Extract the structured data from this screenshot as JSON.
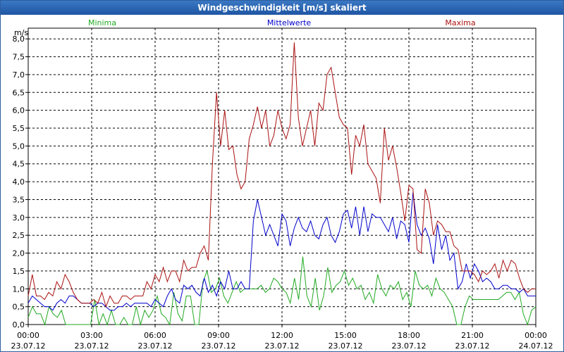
{
  "window": {
    "title": "Windgeschwindigkeit [m/s] skaliert"
  },
  "chart_data": {
    "type": "line",
    "title": "Windgeschwindigkeit [m/s] skaliert",
    "ylabel": "m/s",
    "ylim": [
      0,
      8
    ],
    "xlim": [
      0,
      96
    ],
    "grid": true,
    "legend": "top",
    "yticks": [
      "0,0",
      "0,5",
      "1,0",
      "1,5",
      "2,0",
      "2,5",
      "3,0",
      "3,5",
      "4,0",
      "4,5",
      "5,0",
      "5,5",
      "6,0",
      "6,5",
      "7,0",
      "7,5",
      "8,0"
    ],
    "xticks": [
      {
        "time": "00:00",
        "date": "23.07.12"
      },
      {
        "time": "03:00",
        "date": "23.07.12"
      },
      {
        "time": "06:00",
        "date": "23.07.12"
      },
      {
        "time": "09:00",
        "date": "23.07.12"
      },
      {
        "time": "12:00",
        "date": "23.07.12"
      },
      {
        "time": "15:00",
        "date": "23.07.12"
      },
      {
        "time": "18:00",
        "date": "23.07.12"
      },
      {
        "time": "21:00",
        "date": "23.07.12"
      },
      {
        "time": "00:00",
        "date": "24.07.12"
      }
    ],
    "series": [
      {
        "name": "Minima",
        "color": "#22aa22",
        "values": [
          0.2,
          0.5,
          0.3,
          0.3,
          0.0,
          0.5,
          0.3,
          0.2,
          0.4,
          0.0,
          0.0,
          0.0,
          0.0,
          0.0,
          0.0,
          0.0,
          0.7,
          0.0,
          0.3,
          0.0,
          0.4,
          0.0,
          0.0,
          0.2,
          0.0,
          0.0,
          0.5,
          0.0,
          0.4,
          0.2,
          0.4,
          0.8,
          0.3,
          0.2,
          0.0,
          0.9,
          0.3,
          0.1,
          0.8,
          0.8,
          0.0,
          0.0,
          1.2,
          1.5,
          0.9,
          1.0,
          1.3,
          0.8,
          0.6,
          0.9,
          1.2,
          0.9,
          1.0,
          1.0,
          1.0,
          1.0,
          1.1,
          0.9,
          1.0,
          1.3,
          1.2,
          1.0,
          0.9,
          0.6,
          1.3,
          0.7,
          1.9,
          0.8,
          0.5,
          1.3,
          0.4,
          0.8,
          1.6,
          0.9,
          1.1,
          1.2,
          1.5,
          1.1,
          1.3,
          1.0,
          1.1,
          0.7,
          0.9,
          0.6,
          1.4,
          1.0,
          0.8,
          1.1,
          1.0,
          1.2,
          0.7,
          0.9,
          0.5,
          1.5,
          1.1,
          1.0,
          1.1,
          0.8,
          1.3,
          1.0,
          0.9,
          0.7,
          0.5,
          0.0,
          0.0,
          0.5,
          0.8,
          0.7,
          0.7,
          0.7,
          0.7,
          0.7,
          0.7,
          0.7,
          0.8,
          0.9,
          0.9,
          0.7,
          0.9,
          0.3,
          0.0,
          0.4,
          0.5
        ]
      },
      {
        "name": "Mittelwerte",
        "color": "#0000cc",
        "values": [
          0.6,
          0.8,
          0.7,
          0.6,
          0.5,
          0.5,
          0.4,
          0.6,
          0.7,
          0.6,
          0.8,
          0.8,
          0.7,
          0.6,
          0.6,
          0.6,
          0.5,
          0.6,
          0.6,
          0.5,
          0.4,
          0.4,
          0.5,
          0.5,
          0.6,
          0.5,
          0.6,
          0.6,
          0.6,
          0.6,
          0.5,
          0.7,
          0.6,
          0.5,
          0.8,
          1.0,
          0.7,
          0.6,
          1.1,
          1.0,
          1.1,
          0.9,
          0.8,
          1.3,
          0.9,
          1.1,
          0.8,
          1.2,
          1.0,
          1.5,
          1.0,
          1.0,
          1.2,
          1.0,
          1.0,
          2.9,
          3.5,
          3.0,
          2.5,
          2.8,
          2.5,
          2.2,
          3.1,
          2.9,
          2.2,
          2.7,
          3.0,
          2.7,
          2.6,
          2.9,
          2.5,
          2.4,
          2.8,
          3.0,
          2.5,
          2.3,
          2.6,
          3.1,
          3.2,
          2.7,
          3.3,
          2.5,
          3.3,
          2.6,
          3.1,
          3.0,
          3.0,
          2.8,
          2.6,
          3.0,
          2.4,
          2.9,
          2.8,
          2.3,
          3.7,
          2.8,
          2.5,
          2.7,
          2.4,
          1.7,
          2.8,
          2.1,
          2.5,
          1.8,
          2.0,
          1.0,
          1.2,
          1.7,
          1.3,
          1.7,
          1.5,
          1.2,
          1.3,
          1.2,
          1.0,
          1.0,
          1.1,
          1.1,
          1.0,
          1.0,
          0.9,
          1.0,
          0.8,
          0.8,
          0.8
        ]
      },
      {
        "name": "Maxima",
        "color": "#aa1111",
        "values": [
          0.8,
          1.4,
          0.8,
          0.8,
          0.7,
          0.9,
          0.8,
          1.2,
          1.0,
          1.4,
          1.2,
          0.9,
          0.7,
          0.6,
          0.6,
          0.6,
          0.7,
          0.6,
          0.9,
          0.5,
          0.8,
          0.6,
          0.6,
          0.8,
          0.8,
          0.7,
          0.8,
          0.8,
          0.8,
          1.2,
          1.0,
          1.4,
          1.2,
          1.6,
          1.2,
          1.5,
          1.5,
          1.2,
          1.8,
          1.5,
          1.6,
          1.6,
          2.0,
          2.2,
          1.8,
          4.5,
          6.5,
          5.0,
          6.0,
          4.9,
          5.0,
          4.2,
          3.8,
          4.0,
          5.2,
          5.6,
          6.1,
          5.5,
          6.0,
          5.0,
          5.3,
          6.0,
          5.5,
          5.2,
          5.6,
          7.9,
          5.8,
          5.0,
          5.5,
          6.0,
          5.0,
          6.2,
          6.0,
          7.0,
          7.2,
          6.5,
          5.8,
          5.6,
          5.5,
          4.2,
          5.3,
          5.0,
          5.6,
          4.5,
          4.3,
          4.1,
          3.4,
          5.5,
          4.6,
          5.0,
          4.4,
          3.7,
          2.9,
          3.9,
          3.8,
          2.1,
          2.0,
          3.8,
          3.4,
          2.5,
          2.9,
          2.8,
          2.6,
          2.6,
          2.2,
          2.1,
          1.5,
          1.5,
          1.5,
          1.4,
          1.2,
          1.5,
          1.4,
          1.5,
          1.7,
          1.3,
          1.8,
          1.5,
          1.8,
          1.7,
          1.3,
          1.0,
          0.9,
          1.0,
          1.0
        ]
      }
    ]
  }
}
